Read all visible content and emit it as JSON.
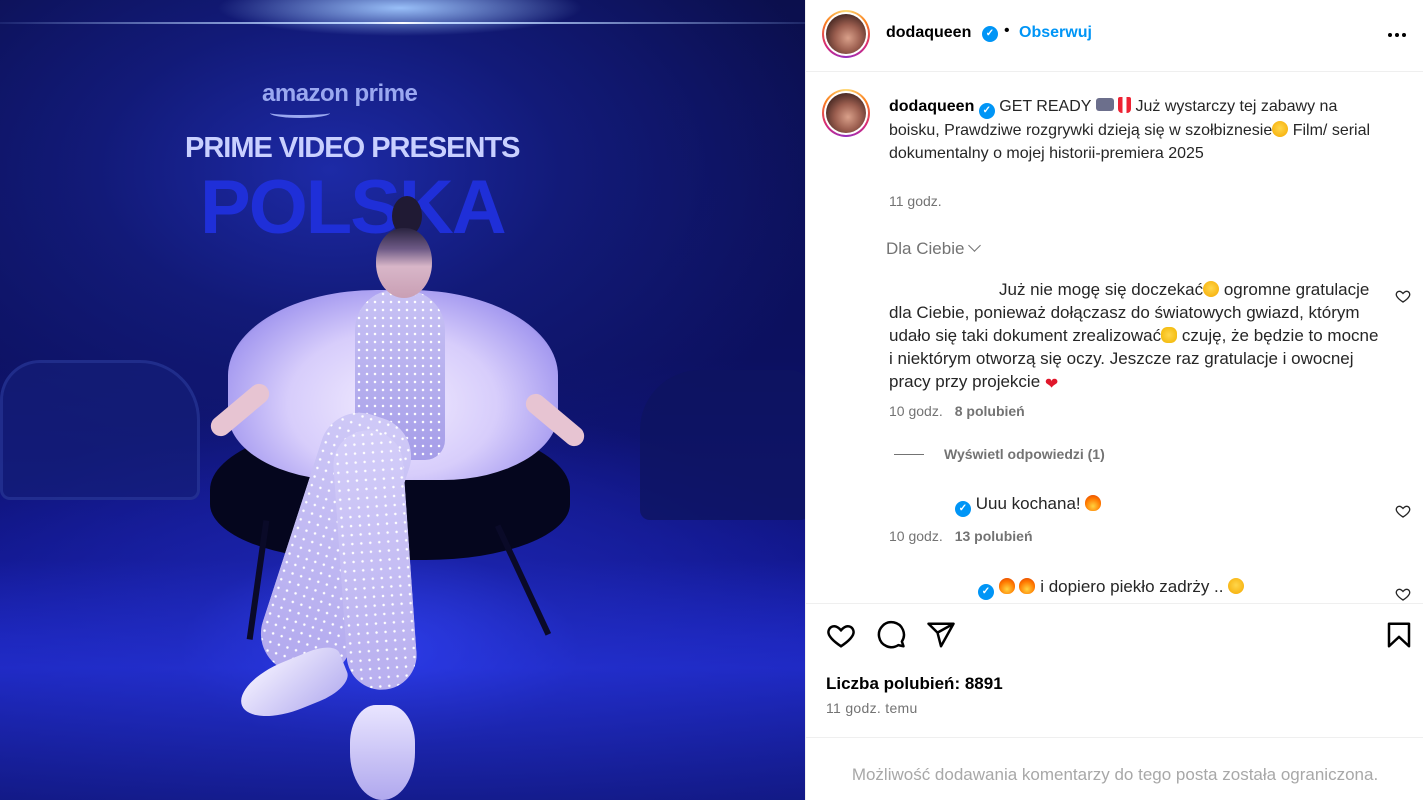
{
  "photo": {
    "brand_line1": "amazon prime",
    "brand_line2": "PRIME VIDEO PRESENTS",
    "brand_line3": "POLSKA"
  },
  "header": {
    "username": "dodaqueen",
    "verified_mark": "✓",
    "separator": "•",
    "follow_label": "Obserwuj"
  },
  "caption": {
    "username": "dodaqueen",
    "text_part1": "GET READY",
    "text_part2": "Już wystarczy tej zabawy na boisku, Prawdziwe rozgrywki dzieją się w szołbiznesie",
    "text_part3": " Film/ serial dokumentalny o mojej historii-premiera 2025",
    "time": "11 godz."
  },
  "comments_filter": {
    "label": "Dla Ciebie"
  },
  "comments": [
    {
      "text_part1": "Już nie mogę się doczekać",
      "text_part2": " ogromne gratulacje dla Ciebie, ponieważ dołączasz do światowych gwiazd, którym udało się taki dokument zrealizować",
      "text_part3": " czuję, że będzie to mocne i niektórym otworzą się oczy. Jeszcze raz gratulacje i owocnej pracy przy projekcie ",
      "heart": "❤",
      "time": "10 godz.",
      "likes": "8 polubień",
      "view_replies": "Wyświetl odpowiedzi (1)"
    },
    {
      "text": "Uuu kochana! ",
      "time": "10 godz.",
      "likes": "13 polubień"
    },
    {
      "text": " i dopiero piekło zadrży .. "
    }
  ],
  "footer": {
    "likes_label": "Liczba polubień: 8891",
    "posted_time": "11 godz. temu",
    "restricted_notice": "Możliwość dodawania komentarzy do tego posta została ograniczona."
  },
  "icons": {
    "like": "heart-icon",
    "comment": "comment-icon",
    "share": "share-icon",
    "save": "bookmark-icon",
    "more": "more-options-icon"
  },
  "colors": {
    "accent": "#0095f6",
    "secondary_text": "#737373",
    "muted_text": "#a8a8a8"
  }
}
